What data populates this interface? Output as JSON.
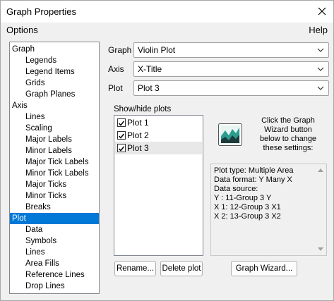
{
  "window": {
    "title": "Graph Properties",
    "close_label": "✕"
  },
  "menu": {
    "options": "Options",
    "help": "Help"
  },
  "tree": {
    "items": [
      {
        "label": "Graph",
        "level": 0
      },
      {
        "label": "Legends",
        "level": 1
      },
      {
        "label": "Legend Items",
        "level": 1
      },
      {
        "label": "Grids",
        "level": 1
      },
      {
        "label": "Graph Planes",
        "level": 1
      },
      {
        "label": "Axis",
        "level": 0
      },
      {
        "label": "Lines",
        "level": 1
      },
      {
        "label": "Scaling",
        "level": 1
      },
      {
        "label": "Major Labels",
        "level": 1
      },
      {
        "label": "Minor Labels",
        "level": 1
      },
      {
        "label": "Major Tick Labels",
        "level": 1
      },
      {
        "label": "Minor Tick Labels",
        "level": 1
      },
      {
        "label": "Major Ticks",
        "level": 1
      },
      {
        "label": "Minor Ticks",
        "level": 1
      },
      {
        "label": "Breaks",
        "level": 1
      },
      {
        "label": "Plot",
        "level": 0,
        "selected": true
      },
      {
        "label": "Data",
        "level": 1
      },
      {
        "label": "Symbols",
        "level": 1
      },
      {
        "label": "Lines",
        "level": 1
      },
      {
        "label": "Area Fills",
        "level": 1
      },
      {
        "label": "Reference Lines",
        "level": 1
      },
      {
        "label": "Drop Lines",
        "level": 1
      }
    ]
  },
  "fields": {
    "graph_label": "Graph",
    "graph_value": "Violin Plot",
    "axis_label": "Axis",
    "axis_value": "X-Title",
    "plot_label": "Plot",
    "plot_value": "Plot 3"
  },
  "plots": {
    "heading": "Show/hide plots",
    "items": [
      {
        "label": "Plot 1",
        "checked": true
      },
      {
        "label": "Plot 2",
        "checked": true
      },
      {
        "label": "Plot 3",
        "checked": true
      }
    ]
  },
  "wizard": {
    "text_lines": [
      "Click the Graph",
      "Wizard button",
      "below to change",
      "these settings:"
    ],
    "info_lines": [
      "Plot type: Multiple Area",
      "Data format: Y Many X",
      "Data source:",
      "Y : 11-Group 3 Y",
      "X 1: 12-Group 3 X1",
      "X 2: 13-Group 3 X2"
    ]
  },
  "buttons": {
    "rename": "Rename...",
    "delete": "Delete plot",
    "wizard": "Graph Wizard..."
  },
  "colors": {
    "selection": "#0078d7",
    "wizard_icon_teal": "#2a9d8f",
    "wizard_icon_dark": "#1d3b3a"
  }
}
